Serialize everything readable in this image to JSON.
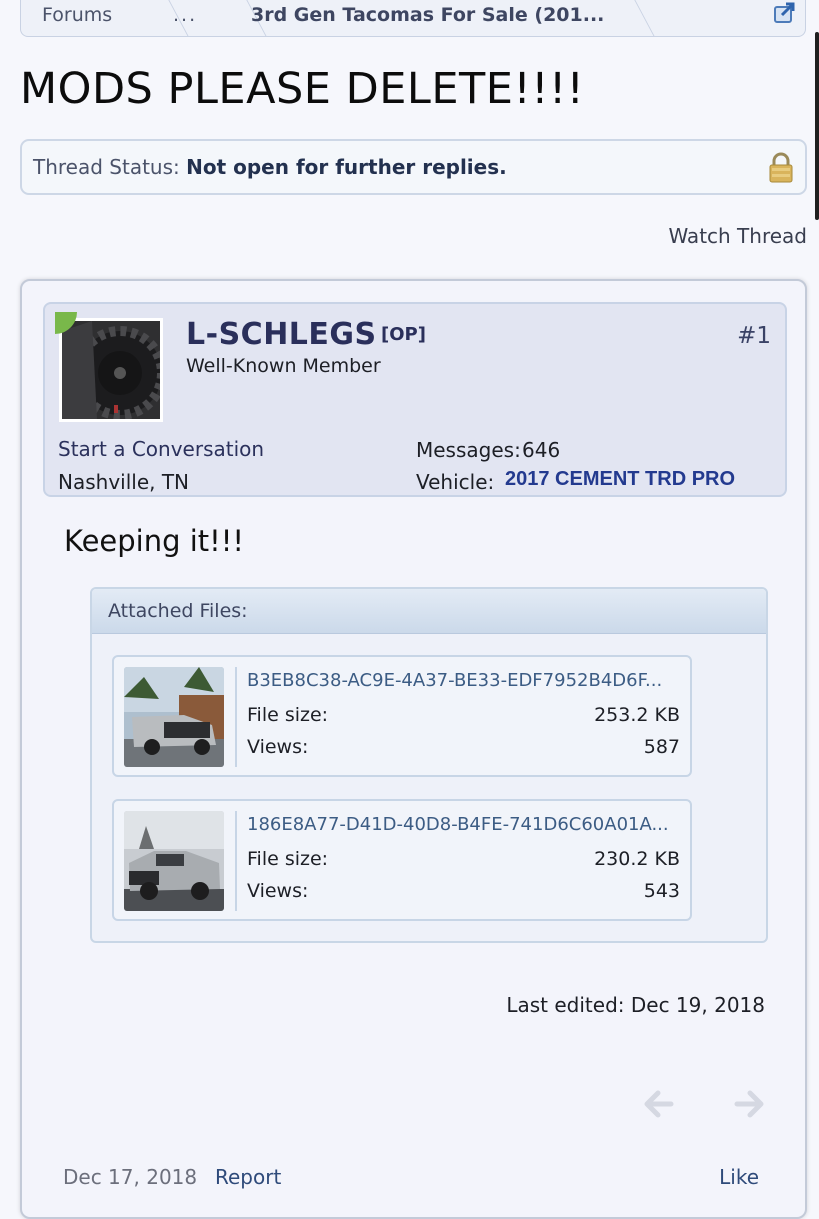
{
  "breadcrumb": {
    "items": [
      "Forums",
      "...",
      "3rd Gen Tacomas For Sale (201..."
    ]
  },
  "thread": {
    "title": "MODS PLEASE DELETE!!!!",
    "status_label": "Thread Status:",
    "status_value": "Not open for further replies.",
    "watch_label": "Watch Thread"
  },
  "post": {
    "username": "L-SCHLEGS",
    "op_tag": "[OP]",
    "number": "#1",
    "rank": "Well-Known Member",
    "start_conversation": "Start a Conversation",
    "location": "Nashville, TN",
    "messages_label": "Messages:",
    "messages_value": "646",
    "vehicle_label": "Vehicle:",
    "vehicle_value": "2017 CEMENT TRD PRO",
    "message": "Keeping it!!!",
    "attachments_title": "Attached Files:",
    "attachments": [
      {
        "name": "B3EB8C38-AC9E-4A37-BE33-EDF7952B4D6F...",
        "size_label": "File size:",
        "size": "253.2 KB",
        "views_label": "Views:",
        "views": "587"
      },
      {
        "name": "186E8A77-D41D-40D8-B4FE-741D6C60A01A...",
        "size_label": "File size:",
        "size": "230.2 KB",
        "views_label": "Views:",
        "views": "543"
      }
    ],
    "last_edited": "Last edited: Dec 19, 2018",
    "date": "Dec 17, 2018",
    "report_label": "Report",
    "like_label": "Like"
  },
  "icons": {
    "jump": "external-link-icon",
    "lock": "lock-icon",
    "prev": "arrow-left-icon",
    "next": "arrow-right-icon"
  },
  "colors": {
    "background": "#f6f7fc",
    "username": "#2a2f5b",
    "vehicle": "#233a8f",
    "link": "#2e4a7a"
  }
}
